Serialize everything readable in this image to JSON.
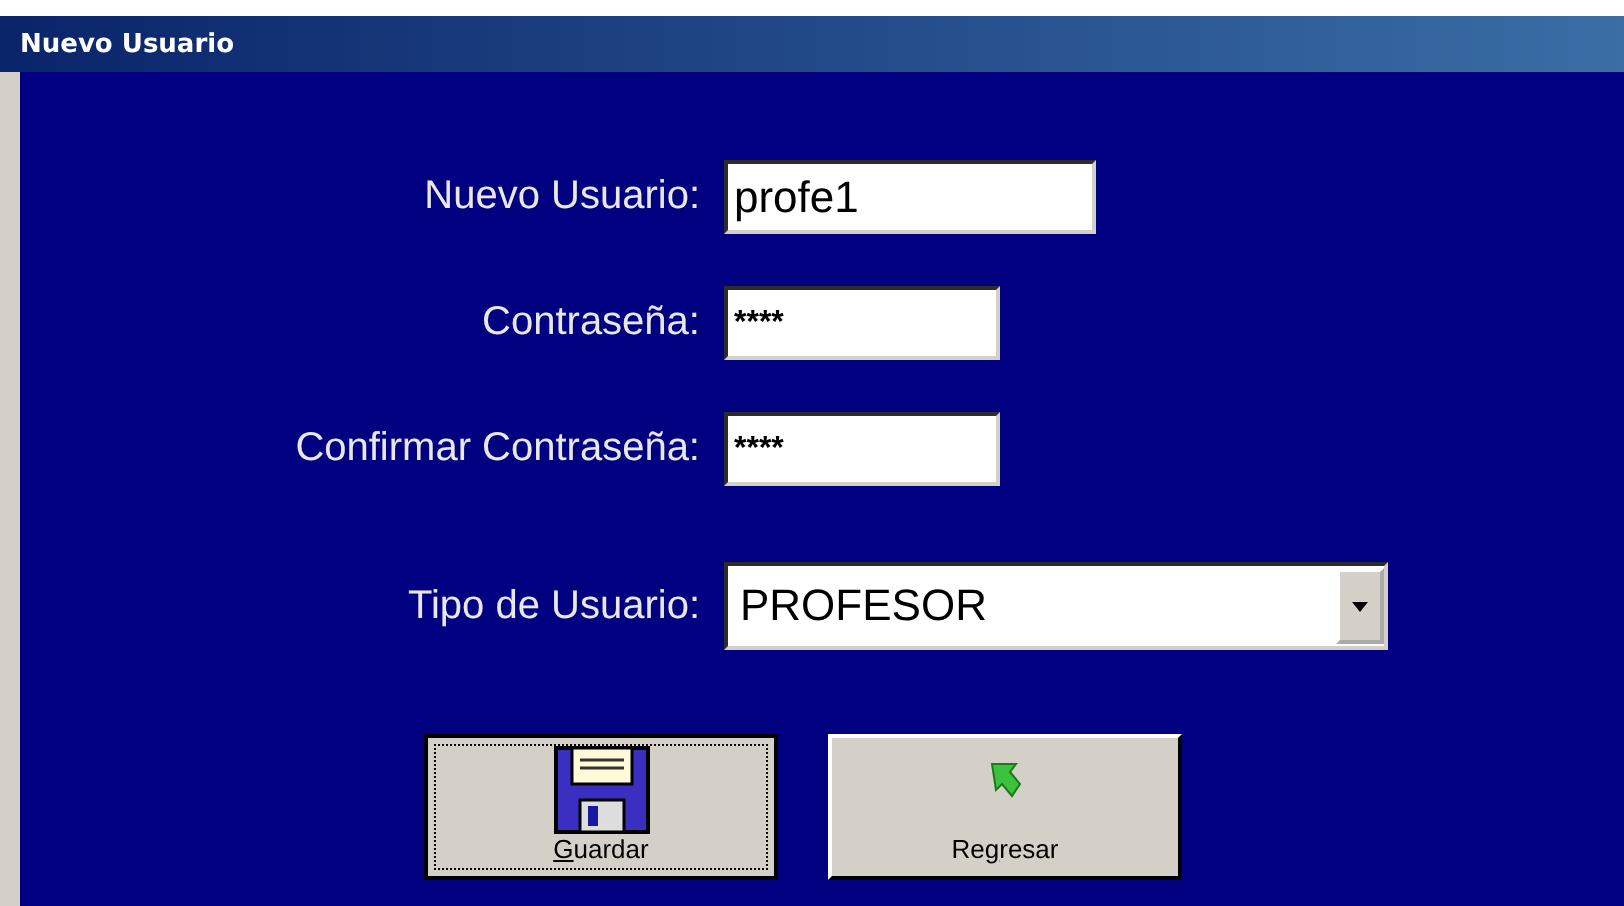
{
  "window": {
    "title": "Nuevo Usuario"
  },
  "fields": [
    {
      "label": "Nuevo Usuario:",
      "value": "profe1",
      "kind": "text"
    },
    {
      "label": "Contraseña:",
      "value": "****",
      "kind": "password"
    },
    {
      "label": "Confirmar Contraseña:",
      "value": "****",
      "kind": "password"
    },
    {
      "label": "Tipo de Usuario:",
      "value": "PROFESOR",
      "kind": "dropdown"
    }
  ],
  "buttons": [
    {
      "label": "Guardar",
      "focused": true,
      "kind": "save"
    },
    {
      "label": "Regresar",
      "focused": false,
      "kind": "back"
    }
  ]
}
